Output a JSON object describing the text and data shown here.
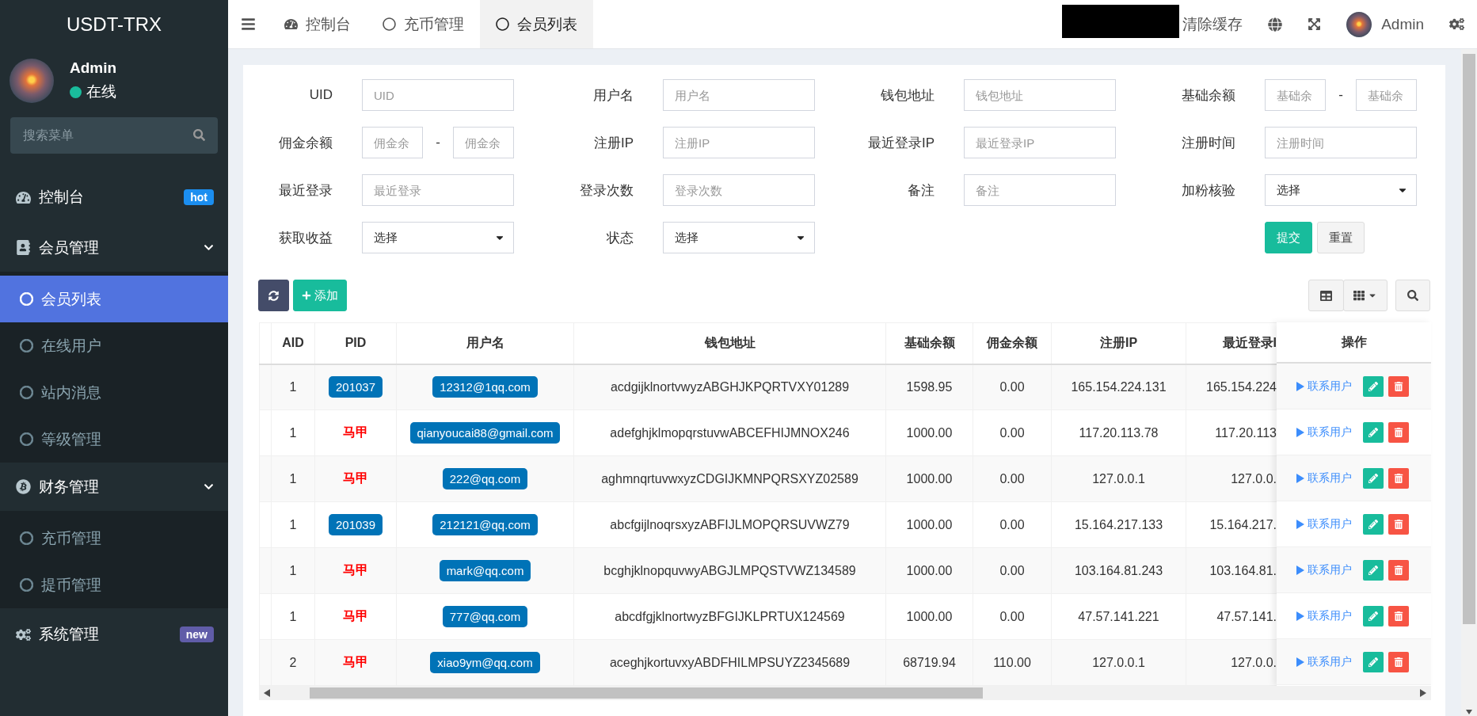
{
  "sidebar": {
    "logo": "USDT-TRX",
    "user": {
      "name": "Admin",
      "status": "在线",
      "online": true
    },
    "search": {
      "placeholder": "搜索菜单"
    },
    "menu": [
      {
        "label": "控制台",
        "badge": {
          "text": "hot",
          "color": "#1b8ef0"
        }
      },
      {
        "label": "会员管理",
        "expanded": true,
        "children": [
          {
            "label": "会员列表",
            "selected": true
          },
          {
            "label": "在线用户",
            "selected": false
          },
          {
            "label": "站内消息",
            "selected": false
          },
          {
            "label": "等级管理",
            "selected": false
          }
        ]
      },
      {
        "label": "财务管理",
        "expanded": true,
        "children": [
          {
            "label": "充币管理",
            "selected": false
          },
          {
            "label": "提币管理",
            "selected": false
          }
        ]
      },
      {
        "label": "系统管理",
        "badge": {
          "text": "new",
          "color": "#605ca8"
        }
      }
    ]
  },
  "topbar": {
    "tabs": [
      {
        "label": "控制台",
        "selected": false
      },
      {
        "label": "充币管理",
        "selected": false
      },
      {
        "label": "会员列表",
        "selected": true
      }
    ],
    "clear_cache": "清除缓存",
    "user": "Admin"
  },
  "filters": [
    {
      "label": "UID",
      "kind": "text",
      "placeholder": "UID"
    },
    {
      "label": "用户名",
      "kind": "text",
      "placeholder": "用户名"
    },
    {
      "label": "钱包地址",
      "kind": "text",
      "placeholder": "钱包地址"
    },
    {
      "label": "基础余额",
      "kind": "range",
      "placeholders": [
        "基础余",
        "基础余"
      ],
      "separator": "-"
    },
    {
      "label": "佣金余额",
      "kind": "range",
      "placeholders": [
        "佣金余",
        "佣金余"
      ],
      "separator": "-"
    },
    {
      "label": "注册IP",
      "kind": "text",
      "placeholder": "注册IP"
    },
    {
      "label": "最近登录IP",
      "kind": "text",
      "placeholder": "最近登录IP"
    },
    {
      "label": "注册时间",
      "kind": "text",
      "placeholder": "注册时间"
    },
    {
      "label": "最近登录",
      "kind": "text",
      "placeholder": "最近登录"
    },
    {
      "label": "登录次数",
      "kind": "text",
      "placeholder": "登录次数"
    },
    {
      "label": "备注",
      "kind": "text",
      "placeholder": "备注"
    },
    {
      "label": "加粉核验",
      "kind": "select",
      "value": "选择"
    },
    {
      "label": "获取收益",
      "kind": "select",
      "value": "选择"
    },
    {
      "label": "状态",
      "kind": "select",
      "value": "选择"
    }
  ],
  "form_buttons": [
    "提交",
    "重置"
  ],
  "toolbar": {
    "add": "添加"
  },
  "table": {
    "columns": [
      "AID",
      "PID",
      "用户名",
      "钱包地址",
      "基础余额",
      "佣金余额",
      "注册IP",
      "最近登录I",
      "操作"
    ],
    "rows": [
      {
        "aid": "1",
        "pid": {
          "kind": "badge",
          "text": "201037"
        },
        "username": "12312@1qq.com",
        "wallet": "acdgijklnortvwyzABGHJKPQRTVXY01289",
        "base": "1598.95",
        "commission": "0.00",
        "reg_ip": "165.154.224.131",
        "last_ip": "165.154.224",
        "action": "联系用户"
      },
      {
        "aid": "1",
        "pid": {
          "kind": "tag",
          "text": "马甲"
        },
        "username": "qianyoucai88@gmail.com",
        "wallet": "adefghjklmopqrstuvwABCEFHIJMNOX246",
        "base": "1000.00",
        "commission": "0.00",
        "reg_ip": "117.20.113.78",
        "last_ip": "117.20.113",
        "action": "联系用户"
      },
      {
        "aid": "1",
        "pid": {
          "kind": "tag",
          "text": "马甲"
        },
        "username": "222@qq.com",
        "wallet": "aghmnqrtuvwxyzCDGIJKMNPQRSXYZ02589",
        "base": "1000.00",
        "commission": "0.00",
        "reg_ip": "127.0.0.1",
        "last_ip": "127.0.0.",
        "action": "联系用户"
      },
      {
        "aid": "1",
        "pid": {
          "kind": "badge",
          "text": "201039"
        },
        "username": "212121@qq.com",
        "wallet": "abcfgijlnoqrsxyzABFIJLMOPQRSUVWZ79",
        "base": "1000.00",
        "commission": "0.00",
        "reg_ip": "15.164.217.133",
        "last_ip": "15.164.217.",
        "action": "联系用户"
      },
      {
        "aid": "1",
        "pid": {
          "kind": "tag",
          "text": "马甲"
        },
        "username": "mark@qq.com",
        "wallet": "bcghjklnopquvwyABGJLMPQSTVWZ134589",
        "base": "1000.00",
        "commission": "0.00",
        "reg_ip": "103.164.81.243",
        "last_ip": "103.164.81.",
        "action": "联系用户"
      },
      {
        "aid": "1",
        "pid": {
          "kind": "tag",
          "text": "马甲"
        },
        "username": "777@qq.com",
        "wallet": "abcdfgjklnortwyzBFGIJKLPRTUX124569",
        "base": "1000.00",
        "commission": "0.00",
        "reg_ip": "47.57.141.221",
        "last_ip": "47.57.141.",
        "action": "联系用户"
      },
      {
        "aid": "2",
        "pid": {
          "kind": "tag",
          "text": "马甲"
        },
        "username": "xiao9ym@qq.com",
        "wallet": "aceghjkortuvxyABDFHILMPSUYZ2345689",
        "base": "68719.94",
        "commission": "110.00",
        "reg_ip": "127.0.0.1",
        "last_ip": "127.0.0.",
        "action": "联系用户"
      }
    ]
  }
}
